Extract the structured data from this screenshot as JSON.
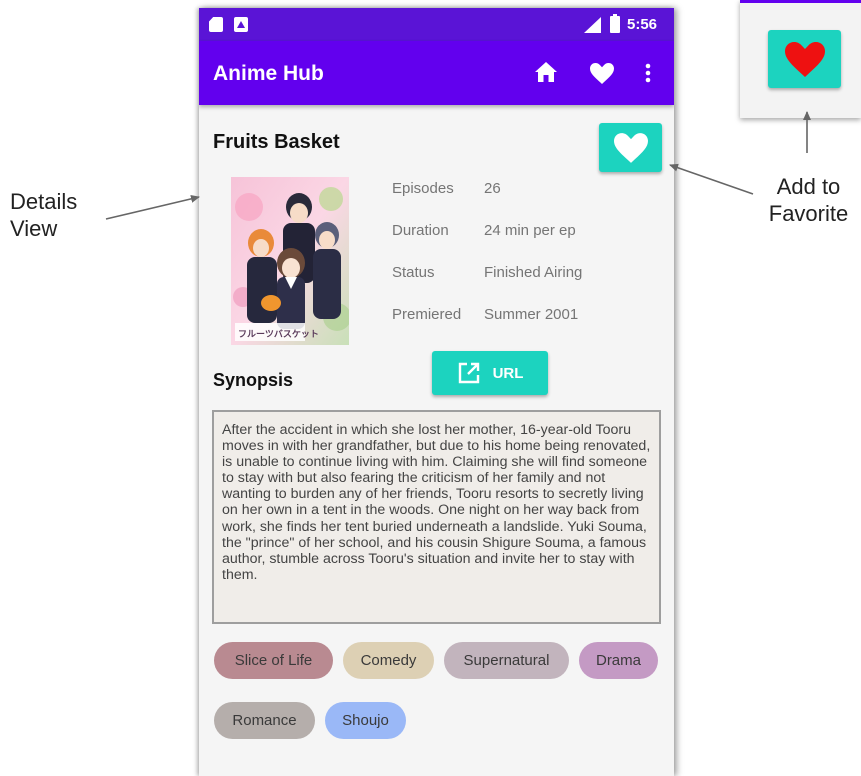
{
  "status_bar": {
    "time": "5:56"
  },
  "app_bar": {
    "title": "Anime Hub",
    "icons": [
      "home-icon",
      "heart-icon",
      "more-vert-icon"
    ]
  },
  "anime": {
    "title": "Fruits Basket",
    "poster_caption": "フルーツバスケット",
    "details": [
      {
        "label": "Episodes",
        "value": "26"
      },
      {
        "label": "Duration",
        "value": "24 min per ep"
      },
      {
        "label": "Status",
        "value": "Finished Airing"
      },
      {
        "label": "Premiered",
        "value": "Summer 2001"
      }
    ],
    "synopsis_heading": "Synopsis",
    "url_label": "URL",
    "synopsis": "After the accident in which she lost her mother, 16-year-old Tooru moves in with her grandfather, but due to his home being renovated, is unable to continue living with him. Claiming she will find someone to stay with but also fearing the criticism of her family and not wanting to burden any of her friends, Tooru resorts to secretly living on her own in a tent in the woods. One night on her way back from work, she finds her tent buried underneath a landslide. Yuki Souma, the \"prince\" of her school, and his cousin Shigure Souma, a famous author, stumble across Tooru's situation and invite her to stay with them.",
    "genres": [
      {
        "name": "Slice of Life",
        "color": "#b98a91"
      },
      {
        "name": "Comedy",
        "color": "#ddd0b4"
      },
      {
        "name": "Supernatural",
        "color": "#c2b4bd"
      },
      {
        "name": "Drama",
        "color": "#c49ac4"
      },
      {
        "name": "Romance",
        "color": "#b5aeab"
      },
      {
        "name": "Shoujo",
        "color": "#9ab8f7"
      }
    ]
  },
  "annotations": {
    "details_line1": "Details",
    "details_line2": "View",
    "favorite_line1": "Add to",
    "favorite_line2": "Favorite"
  },
  "colors": {
    "primary": "#6200ee",
    "status_bar": "#5a14d6",
    "accent": "#1cd3bf",
    "heart_red": "#ee1111"
  }
}
